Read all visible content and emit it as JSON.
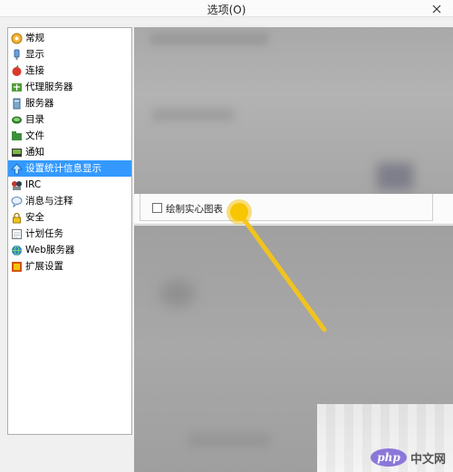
{
  "window": {
    "title": "选项(O)"
  },
  "sidebar": {
    "items": [
      {
        "label": "常规",
        "icon": "general-icon"
      },
      {
        "label": "显示",
        "icon": "display-icon"
      },
      {
        "label": "连接",
        "icon": "connection-icon"
      },
      {
        "label": "代理服务器",
        "icon": "proxy-icon"
      },
      {
        "label": "服务器",
        "icon": "server-icon"
      },
      {
        "label": "目录",
        "icon": "folder-icon"
      },
      {
        "label": "文件",
        "icon": "file-icon"
      },
      {
        "label": "通知",
        "icon": "notification-icon"
      },
      {
        "label": "设置统计信息显示",
        "icon": "statistics-icon",
        "selected": true
      },
      {
        "label": "IRC",
        "icon": "irc-icon"
      },
      {
        "label": "消息与注释",
        "icon": "message-icon"
      },
      {
        "label": "安全",
        "icon": "lock-icon"
      },
      {
        "label": "计划任务",
        "icon": "schedule-icon"
      },
      {
        "label": "Web服务器",
        "icon": "web-server-icon"
      },
      {
        "label": "扩展设置",
        "icon": "extended-settings-icon"
      }
    ]
  },
  "content": {
    "checkbox_label": "绘制实心图表",
    "checkbox_checked": false
  },
  "watermark": {
    "logo_text": "php",
    "suffix": "中文网"
  },
  "colors": {
    "selection": "#3399ff",
    "highlight": "#f5c518"
  }
}
